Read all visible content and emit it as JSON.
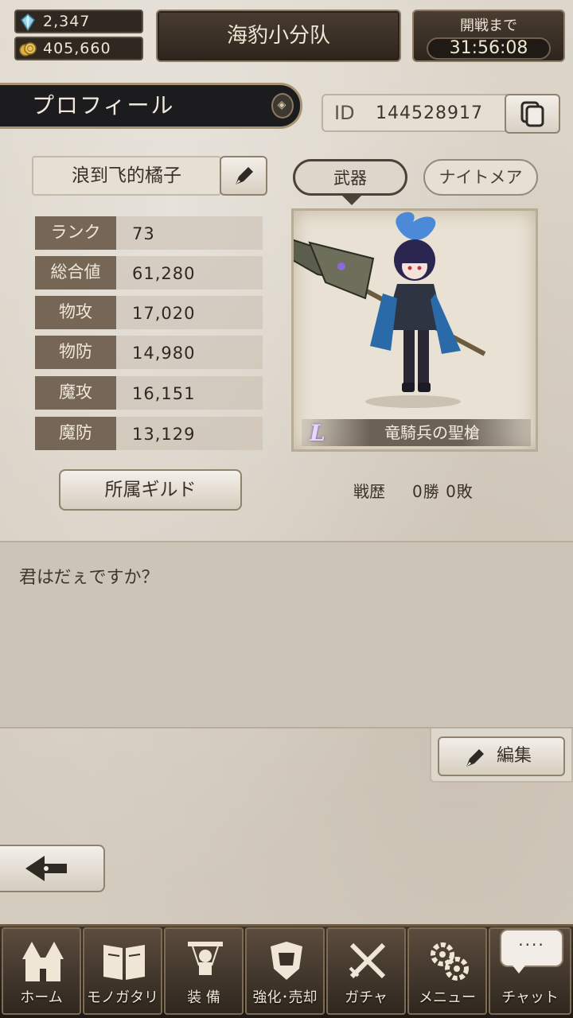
{
  "resources": {
    "gems": "2,347",
    "gold": "405,660"
  },
  "team": {
    "name": "海豹小分队"
  },
  "battle": {
    "label": "開戦まで",
    "timer": "31:56:08"
  },
  "profile": {
    "title": "プロフィール",
    "id_label": "ID",
    "id_value": "144528917",
    "player_name": "浪到飞的橘子",
    "stats": [
      {
        "label": "ランク",
        "value": "73"
      },
      {
        "label": "総合値",
        "value": "61,280"
      },
      {
        "label": "物攻",
        "value": "17,020"
      },
      {
        "label": "物防",
        "value": "14,980"
      },
      {
        "label": "魔攻",
        "value": "16,151"
      },
      {
        "label": "魔防",
        "value": "13,129"
      }
    ],
    "guild_button": "所属ギルド",
    "tabs": {
      "weapon": "武器",
      "nightmare": "ナイトメア"
    },
    "weapon_rarity": "L",
    "weapon_name": "竜騎兵の聖槍",
    "record_label": "戦歴",
    "record_value": "0勝 0敗",
    "message": "君はだぇですか？",
    "edit_button": "編集"
  },
  "nav": {
    "items": [
      {
        "label": "ホーム",
        "icon": "castle-icon"
      },
      {
        "label": "モノガタリ",
        "icon": "book-icon"
      },
      {
        "label": "装 備",
        "icon": "puppet-icon"
      },
      {
        "label": "強化･売却",
        "icon": "armor-icon"
      },
      {
        "label": "ガチャ",
        "icon": "crossed-swords-icon"
      },
      {
        "label": "メニュー",
        "icon": "gears-icon"
      },
      {
        "label": "チャット",
        "icon": "chat-icon"
      }
    ],
    "chat_bubble": "····"
  },
  "colors": {
    "accent_dark": "#2f2820",
    "stat_label_bg": "#756656",
    "paper": "#d9d2c6"
  }
}
